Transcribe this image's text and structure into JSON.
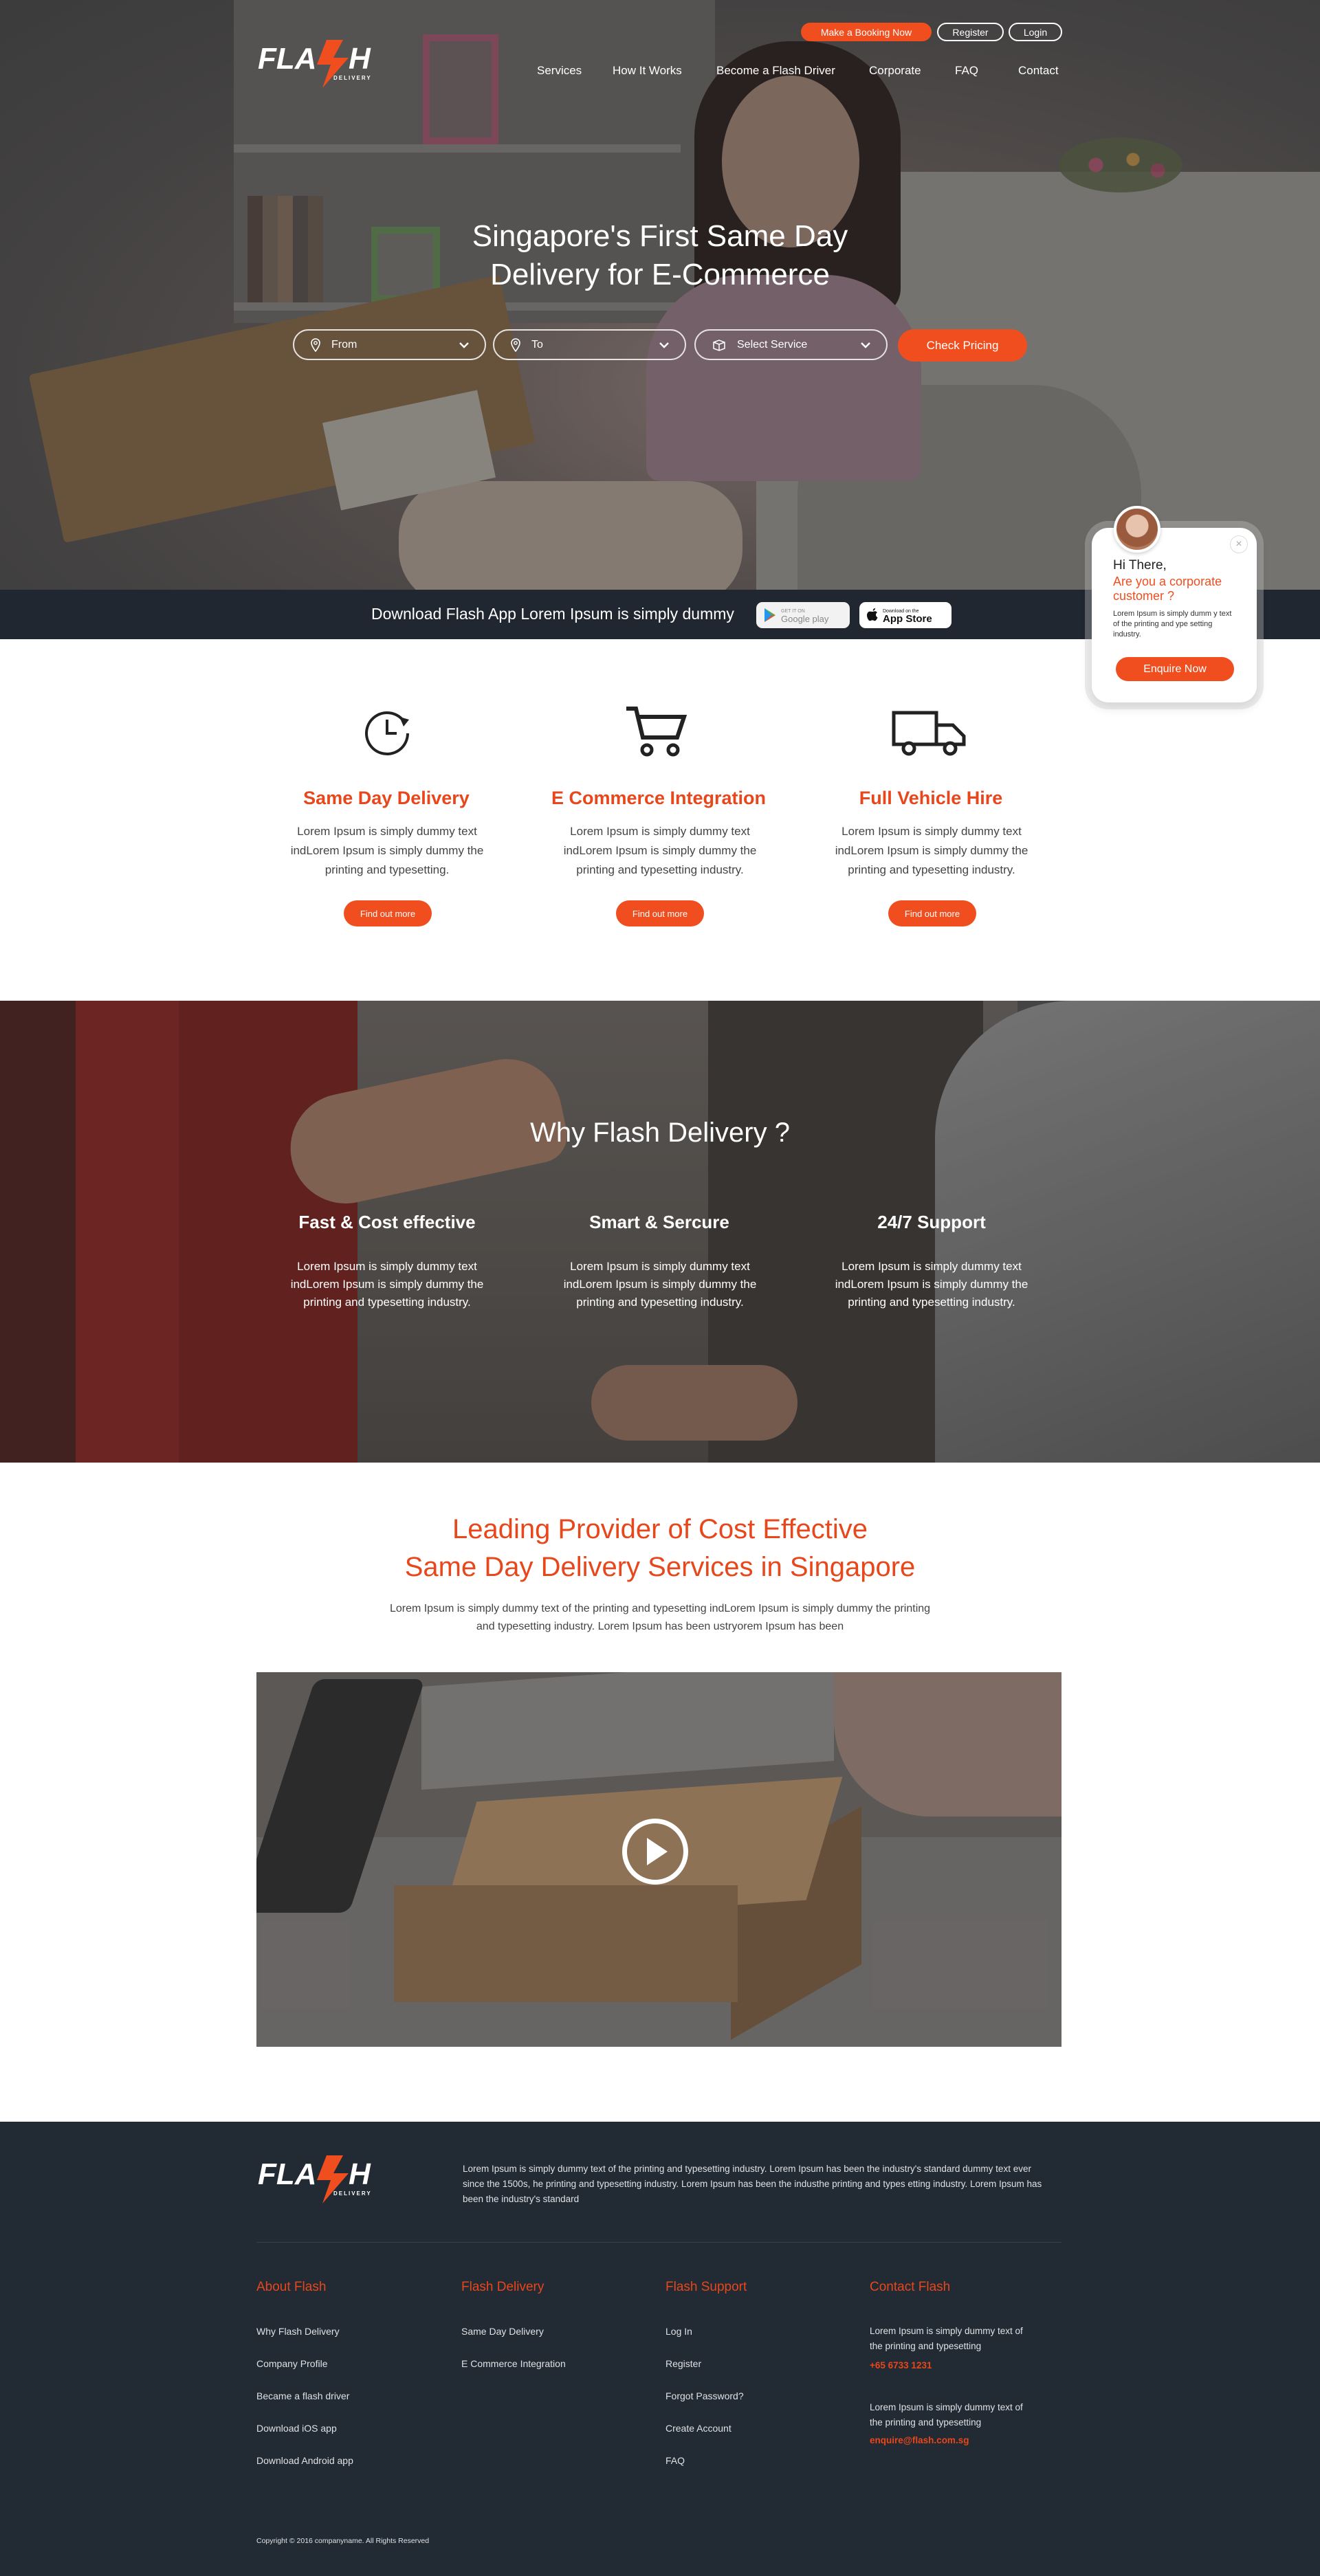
{
  "brand": {
    "logo_text": "FLA",
    "logo_text_end": "H",
    "logo_tagline": "DELIVERY"
  },
  "topbar": {
    "booking": "Make a Booking Now",
    "register": "Register",
    "login": "Login"
  },
  "nav": [
    "Services",
    "How It Works",
    "Become a Flash Driver",
    "Corporate",
    "FAQ",
    "Contact"
  ],
  "hero": {
    "title_line1": "Singapore's First Same Day",
    "title_line2": "Delivery for E-Commerce",
    "from_placeholder": "From",
    "to_placeholder": "To",
    "service_placeholder": "Select Service",
    "cta": "Check Pricing"
  },
  "app_strip": {
    "text": "Download Flash App Lorem Ipsum is simply dummy",
    "google_small": "GET IT ON",
    "google_label": "Google play",
    "apple_small": "Download on the",
    "apple_label": "App Store"
  },
  "chat": {
    "greeting": "Hi There,",
    "question": "Are you a corporate customer ?",
    "body": "Lorem Ipsum is simply dumm y text of the printing and ype setting industry.",
    "cta": "Enquire Now",
    "close": "×"
  },
  "services": [
    {
      "icon": "clock-icon",
      "title": "Same Day Delivery",
      "text": "Lorem Ipsum is simply dummy text indLorem Ipsum is simply dummy the printing and typesetting.",
      "cta": "Find out more"
    },
    {
      "icon": "cart-icon",
      "title": "E Commerce Integration",
      "text": "Lorem Ipsum is simply dummy text indLorem Ipsum is simply dummy the printing and typesetting industry.",
      "cta": "Find out more"
    },
    {
      "icon": "truck-icon",
      "title": "Full Vehicle Hire",
      "text": "Lorem Ipsum is simply dummy text indLorem Ipsum is simply dummy the printing and typesetting industry.",
      "cta": "Find out more"
    }
  ],
  "why": {
    "title": "Why Flash Delivery ?",
    "items": [
      {
        "title": "Fast & Cost effective",
        "text": "Lorem Ipsum is simply dummy text indLorem Ipsum is simply dummy the printing and typesetting industry."
      },
      {
        "title": "Smart & Sercure",
        "text": "Lorem Ipsum is simply dummy text indLorem Ipsum is simply dummy the printing and typesetting industry."
      },
      {
        "title": "24/7 Support",
        "text": "Lorem Ipsum is simply dummy text indLorem Ipsum is simply dummy the printing and typesetting industry."
      }
    ]
  },
  "leading": {
    "title_line1": "Leading Provider of Cost Effective",
    "title_line2": "Same Day Delivery Services in Singapore",
    "text": "Lorem Ipsum is simply dummy text of the printing and typesetting indLorem Ipsum is simply dummy the printing and typesetting industry. Lorem Ipsum has been ustryorem Ipsum has been"
  },
  "footer": {
    "about": "Lorem Ipsum is simply dummy text of the printing and typesetting industry. Lorem Ipsum has been the industry's standard dummy text ever since the 1500s, he printing and typesetting industry. Lorem Ipsum has been the industhe printing and types etting industry. Lorem Ipsum has been the industry's standard",
    "columns": [
      {
        "title": "About Flash",
        "links": [
          "Why Flash Delivery",
          "Company Profile",
          "Became a flash driver",
          "Download iOS app",
          "Download Android app"
        ]
      },
      {
        "title": "Flash Delivery",
        "links": [
          "Same Day Delivery",
          "E Commerce Integration"
        ]
      },
      {
        "title": "Flash Support",
        "links": [
          "Log In",
          "Register",
          "Forgot Password?",
          "Create Account",
          "FAQ"
        ]
      }
    ],
    "contact": {
      "title": "Contact Flash",
      "phone_text": "Lorem Ipsum is simply dummy text of the printing and typesetting",
      "phone": "+65 6733 1231",
      "email_text": "Lorem Ipsum is simply dummy text of the printing and typesetting",
      "email": "enquire@flash.com.sg"
    },
    "copyright": "Copyright © 2016 companyname. All Rights Reserved"
  },
  "colors": {
    "accent": "#f04e1f",
    "footer_bg": "#222a33",
    "strip_bg": "#202730"
  }
}
